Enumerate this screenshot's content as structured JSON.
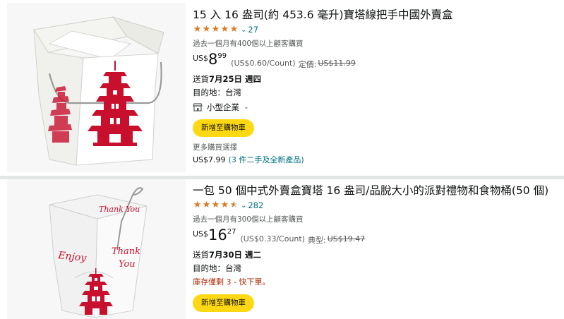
{
  "products": [
    {
      "title": "15 入 16 盎司(約 453.6 毫升)寶塔線把手中國外賣盒",
      "rating_count": "27",
      "bought": "過去一個月有400個以上顧客購買",
      "price_currency": "US$",
      "price_whole": "8",
      "price_fraction": "99",
      "unit_price": "(US$0.60/Count)",
      "list_price_label": "定價:",
      "list_price": "US$11.99",
      "delivery_prefix": "送貨",
      "delivery_date": "7月25日 週四",
      "destination": "目的地：台灣",
      "business_label": "小型企業",
      "add_to_cart": "新增至購物車",
      "more_options": "更多購買選擇",
      "more_price": "US$7.99",
      "more_link": "(3 件二手及全新產品)"
    },
    {
      "title": "一包 50 個中式外賣盒寶塔 16 盎司/品脫大小的派對禮物和食物桶(50 個)",
      "rating_count": "282",
      "bought": "過去一個月有300個以上顧客購買",
      "price_currency": "US$",
      "price_whole": "16",
      "price_fraction": "27",
      "unit_price": "(US$0.33/Count)",
      "list_price_label": "典型:",
      "list_price": "US$19.47",
      "delivery_prefix": "送貨",
      "delivery_date": "7月30日 週二",
      "destination": "目的地：台灣",
      "stock_warning": "庫存僅剩 3 - 快下單。",
      "add_to_cart": "新增至購物車",
      "box_text_1": "Thank You",
      "box_text_2": "Enjoy",
      "box_text_3": "Thank",
      "box_text_4": "You"
    }
  ],
  "colors": {
    "link": "#007185",
    "star": "#de7921",
    "button": "#ffd814",
    "stock": "#b12704",
    "pagoda_red": "#c8102e"
  }
}
